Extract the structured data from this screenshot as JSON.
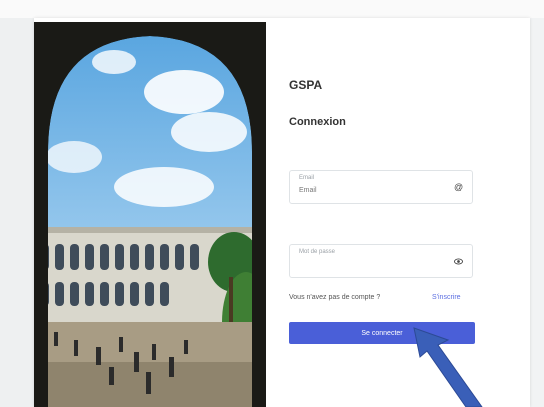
{
  "app": {
    "brand": "GSPA",
    "page_title": "Connexion"
  },
  "login_form": {
    "email_label": "Email",
    "email_value": "Email",
    "password_label": "Mot de passe",
    "forgot_prompt": "Vous n'avez pas de compte ?",
    "forgot_link": "S'inscrire",
    "submit_label": "Se connecter"
  },
  "icons": {
    "email_field": "at-icon",
    "password_field": "eye-icon"
  },
  "colors": {
    "accent": "#4a5fd8",
    "link": "#5b6ee1",
    "annotation_arrow": "#3a5fb8"
  }
}
